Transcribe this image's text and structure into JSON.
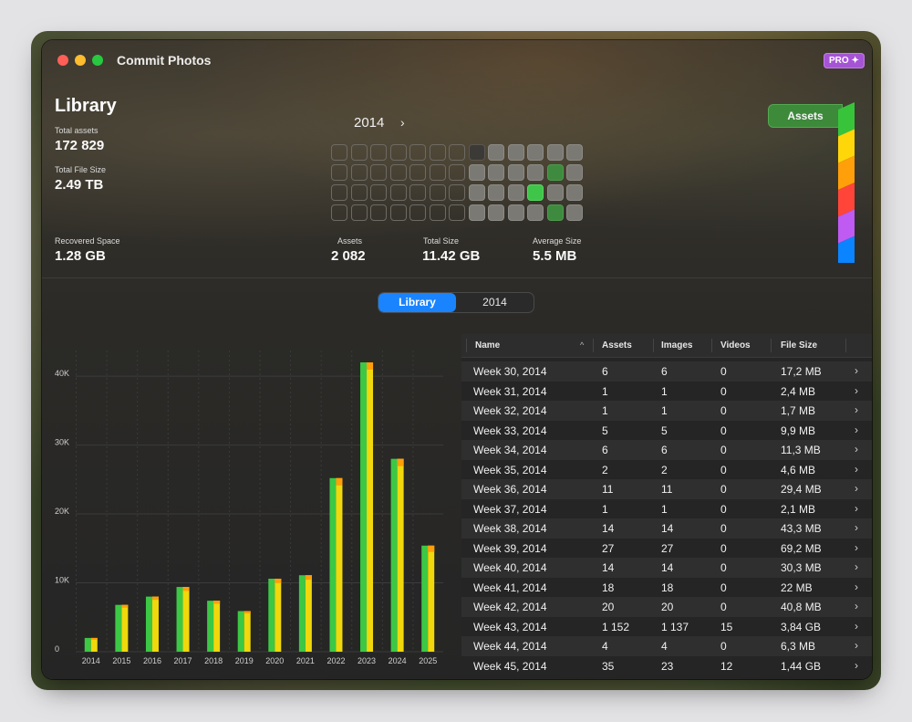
{
  "window": {
    "title": "Commit Photos",
    "badge": "PRO ✦"
  },
  "library": {
    "heading": "Library",
    "total_assets_label": "Total assets",
    "total_assets_value": "172 829",
    "total_size_label": "Total File Size",
    "total_size_value": "2.49 TB",
    "recovered_label": "Recovered Space",
    "recovered_value": "1.28 GB"
  },
  "year_panel": {
    "year": "2014",
    "next_icon": "chevron-right-icon",
    "assets_label": "Assets",
    "assets_value": "2 082",
    "total_size_label": "Total Size",
    "total_size_value": "11.42 GB",
    "avg_label": "Average Size",
    "avg_value": "5.5 MB",
    "calendar": [
      [
        "o",
        "o",
        "o",
        "o",
        "o",
        "o",
        "o",
        "d",
        "f",
        "f",
        "f",
        "f",
        "f"
      ],
      [
        "o",
        "o",
        "o",
        "o",
        "o",
        "o",
        "o",
        "f",
        "f",
        "f",
        "f",
        "dg",
        "f"
      ],
      [
        "o",
        "o",
        "o",
        "o",
        "o",
        "o",
        "o",
        "f",
        "f",
        "f",
        "g",
        "f",
        "f"
      ],
      [
        "o",
        "o",
        "o",
        "o",
        "o",
        "o",
        "o",
        "f",
        "f",
        "f",
        "f",
        "dg",
        "f"
      ]
    ]
  },
  "side_tab": {
    "label": "Assets",
    "colors": [
      "#37c43b",
      "#ffd60a",
      "#ff9f0a",
      "#ff453a",
      "#bf5af2",
      "#0a84ff"
    ]
  },
  "segmented": {
    "options": [
      "Library",
      "2014"
    ],
    "selected": 0
  },
  "chart_data": {
    "type": "bar",
    "categories": [
      "2014",
      "2015",
      "2016",
      "2017",
      "2018",
      "2019",
      "2020",
      "2021",
      "2022",
      "2023",
      "2024",
      "2025"
    ],
    "series": [
      {
        "values": [
          2000,
          6800,
          8000,
          9400,
          7400,
          5900,
          10600,
          11100,
          25200,
          42000,
          28000,
          15400
        ],
        "color": "#3cc844"
      },
      {
        "values": [
          2000,
          6800,
          8000,
          9400,
          7400,
          5900,
          10600,
          11100,
          25200,
          42000,
          28000,
          15400
        ],
        "color": "#f0d80c",
        "top_color": "#ff9f0a"
      }
    ],
    "y_ticks": [
      "0",
      "10K",
      "20K",
      "30K",
      "40K"
    ],
    "ylim": [
      0,
      42000
    ],
    "grid": true
  },
  "table": {
    "columns": [
      "Name",
      "Assets",
      "Images",
      "Videos",
      "File Size"
    ],
    "rows": [
      [
        "Week 30, 2014",
        "6",
        "6",
        "0",
        "17,2 MB"
      ],
      [
        "Week 31, 2014",
        "1",
        "1",
        "0",
        "2,4 MB"
      ],
      [
        "Week 32, 2014",
        "1",
        "1",
        "0",
        "1,7 MB"
      ],
      [
        "Week 33, 2014",
        "5",
        "5",
        "0",
        "9,9 MB"
      ],
      [
        "Week 34, 2014",
        "6",
        "6",
        "0",
        "11,3 MB"
      ],
      [
        "Week 35, 2014",
        "2",
        "2",
        "0",
        "4,6 MB"
      ],
      [
        "Week 36, 2014",
        "11",
        "11",
        "0",
        "29,4 MB"
      ],
      [
        "Week 37, 2014",
        "1",
        "1",
        "0",
        "2,1 MB"
      ],
      [
        "Week 38, 2014",
        "14",
        "14",
        "0",
        "43,3 MB"
      ],
      [
        "Week 39, 2014",
        "27",
        "27",
        "0",
        "69,2 MB"
      ],
      [
        "Week 40, 2014",
        "14",
        "14",
        "0",
        "30,3 MB"
      ],
      [
        "Week 41, 2014",
        "18",
        "18",
        "0",
        "22 MB"
      ],
      [
        "Week 42, 2014",
        "20",
        "20",
        "0",
        "40,8 MB"
      ],
      [
        "Week 43, 2014",
        "1 152",
        "1 137",
        "15",
        "3,84 GB"
      ],
      [
        "Week 44, 2014",
        "4",
        "4",
        "0",
        "6,3 MB"
      ],
      [
        "Week 45, 2014",
        "35",
        "23",
        "12",
        "1,44 GB"
      ]
    ]
  }
}
